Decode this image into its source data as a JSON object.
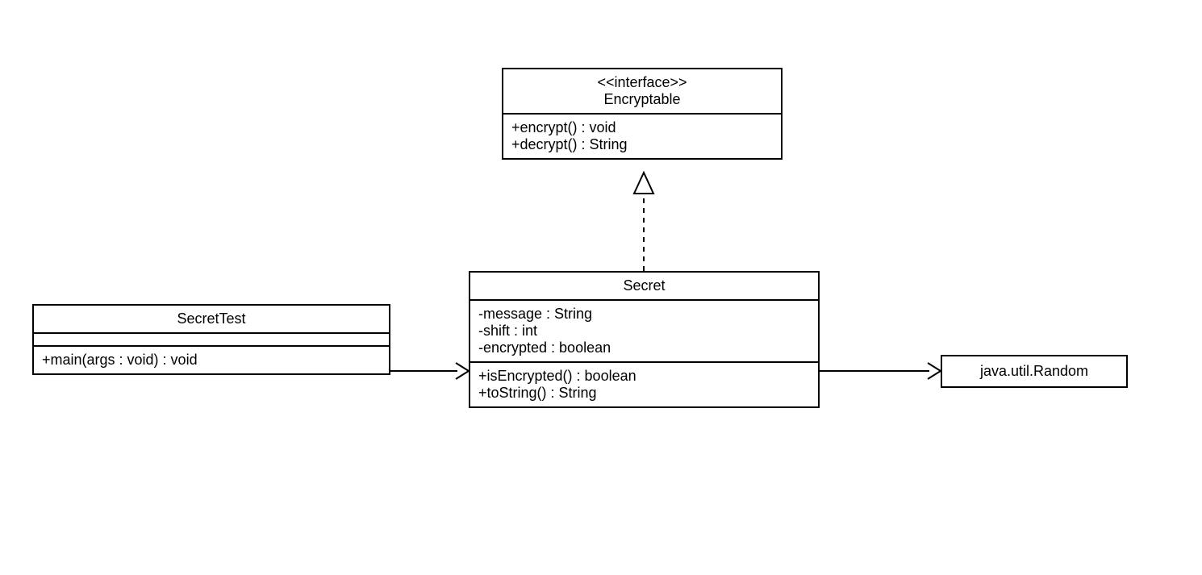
{
  "diagram": {
    "interface": {
      "stereotype": "<<interface>>",
      "name": "Encryptable",
      "methods": [
        "+encrypt() : void",
        "+decrypt() : String"
      ]
    },
    "secret": {
      "name": "Secret",
      "attributes": [
        "-message : String",
        "-shift : int",
        "-encrypted : boolean"
      ],
      "methods": [
        "+isEncrypted() : boolean",
        "+toString() : String"
      ]
    },
    "secretTest": {
      "name": "SecretTest",
      "methods": [
        "+main(args : void) : void"
      ]
    },
    "random": {
      "name": "java.util.Random"
    }
  }
}
